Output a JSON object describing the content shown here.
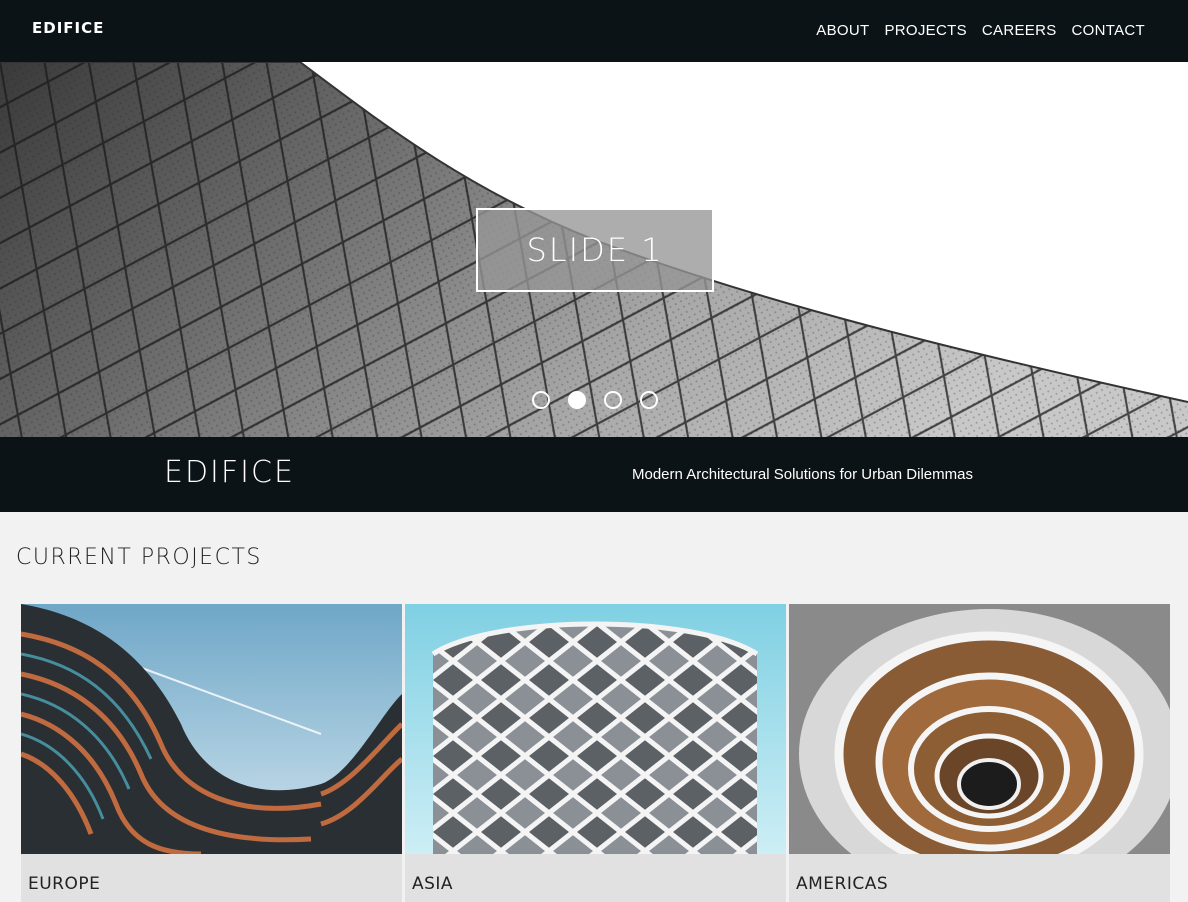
{
  "header": {
    "brand": "EDIFICE",
    "nav": [
      "ABOUT",
      "PROJECTS",
      "CAREERS",
      "CONTACT"
    ]
  },
  "hero": {
    "slide_title": "SLIDE 1",
    "slide_count": 4,
    "active_slide": 2
  },
  "band": {
    "title": "EDIFICE",
    "tagline": "Modern Architectural Solutions for Urban Dilemmas"
  },
  "projects": {
    "heading": "CURRENT PROJECTS",
    "items": [
      {
        "label": "EUROPE"
      },
      {
        "label": "ASIA"
      },
      {
        "label": "AMERICAS"
      }
    ]
  },
  "colors": {
    "dark": "#0c1317",
    "page_bg": "#f2f2f2",
    "card_bg": "#e1e1e1"
  }
}
